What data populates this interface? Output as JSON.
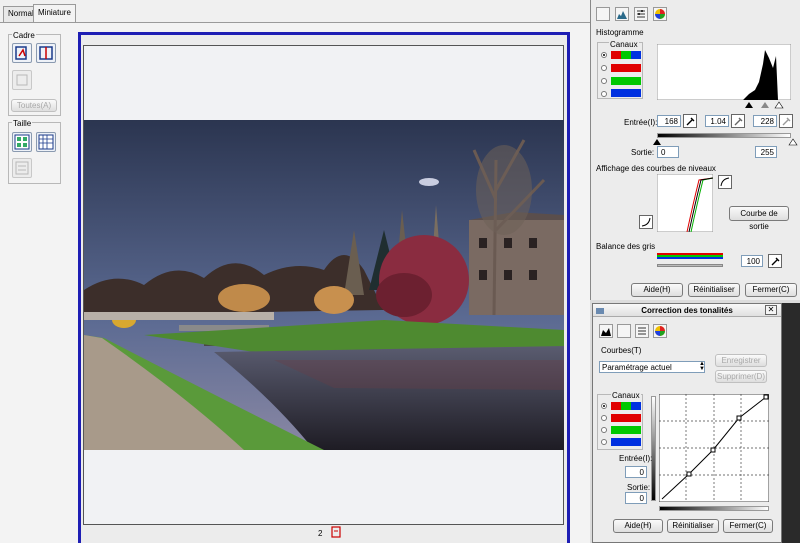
{
  "tabs": [
    {
      "label": "Normal"
    },
    {
      "label": "Miniature"
    }
  ],
  "left": {
    "cadre_title": "Cadre",
    "toutes_label": "Toutes(A)",
    "taille_title": "Taille",
    "page_number": "2"
  },
  "histogram_window": {
    "section_title": "Histogramme",
    "canaux_label": "Canaux",
    "entree_label": "Entrée(I):",
    "entree_values": [
      "168",
      "1.04",
      "228"
    ],
    "sortie_label": "Sortie:",
    "sortie_values": [
      "0",
      "255"
    ],
    "affichage_label": "Affichage des courbes de niveaux",
    "courbe_button": "Courbe de sortie",
    "balance_label": "Balance des gris",
    "balance_value": "100",
    "buttons": {
      "aide": "Aide(H)",
      "reinit": "Réinitialiser",
      "fermer": "Fermer(C)"
    }
  },
  "tone_window": {
    "title": "Correction des tonalités",
    "courbes_label": "Courbes(T)",
    "preset_value": "Paramétrage actuel",
    "enregistrer": "Enregistrer",
    "supprimer": "Supprimer(D)",
    "canaux_label": "Canaux",
    "entree_label": "Entrée(I):",
    "entree_value": "0",
    "sortie_label": "Sortie:",
    "sortie_value": "0",
    "buttons": {
      "aide": "Aide(H)",
      "reinit": "Réinitialiser",
      "fermer": "Fermer(C)"
    }
  },
  "colors": {
    "accent_frame": "#1e1eb4",
    "channel_red": "#e00000",
    "channel_green": "#00c800",
    "channel_blue": "#0030e0"
  }
}
